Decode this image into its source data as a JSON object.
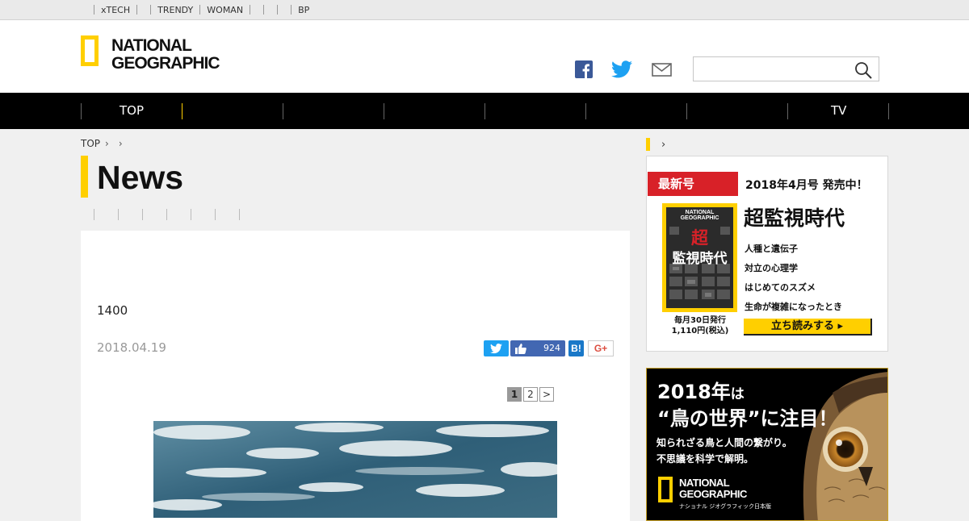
{
  "topbar": {
    "links": [
      "xTECH",
      "TRENDY",
      "WOMAN",
      "BP"
    ]
  },
  "header": {
    "logo_line1": "NATIONAL",
    "logo_line2": "GEOGRAPHIC",
    "search": {
      "value": "",
      "placeholder": ""
    }
  },
  "nav": {
    "items": [
      "TOP",
      "TV"
    ]
  },
  "breadcrumb": {
    "home": "TOP"
  },
  "page_title": "News",
  "article": {
    "headline": "1400",
    "date": "2018.04.19",
    "share": {
      "facebook_count": "924",
      "hatena_label": "B!",
      "gplus_label": "G+"
    },
    "pager": {
      "pages": [
        "1",
        "2"
      ],
      "next": ">",
      "current": "1"
    }
  },
  "magazine": {
    "tag": "最新号",
    "issue": "2018年4月号 発売中！",
    "feature": "超監視時代",
    "topics": [
      "人種と遺伝子",
      "対立の心理学",
      "はじめてのスズメ",
      "生命が複雑になったとき"
    ],
    "cover": {
      "brand_line1": "NATIONAL",
      "brand_line2": "GEOGRAPHIC",
      "big_char": "超",
      "title_rest": "監視時代"
    },
    "release_line1": "毎月30日発行",
    "release_line2": "1,110円(税込)",
    "read_button": "立ち読みする ▸"
  },
  "ad": {
    "headline_year": "2018年",
    "headline_wa": "は",
    "headline_line2": "“鳥の世界”に注目！",
    "sub_line1": "知られざる鳥と人間の繋がり。",
    "sub_line2": "不思議を科学で解明。",
    "brand_line1": "NATIONAL",
    "brand_line2": "GEOGRAPHIC",
    "brand_jp": "ナショナル ジオグラフィック日本版"
  },
  "colors": {
    "brand_yellow": "#ffcf00",
    "nav_black": "#000000",
    "magazine_red": "#d82128",
    "twitter_blue": "#1da1f2",
    "facebook_blue": "#4267b2"
  },
  "icons": [
    "facebook-icon",
    "twitter-icon",
    "mail-icon",
    "search-icon"
  ]
}
